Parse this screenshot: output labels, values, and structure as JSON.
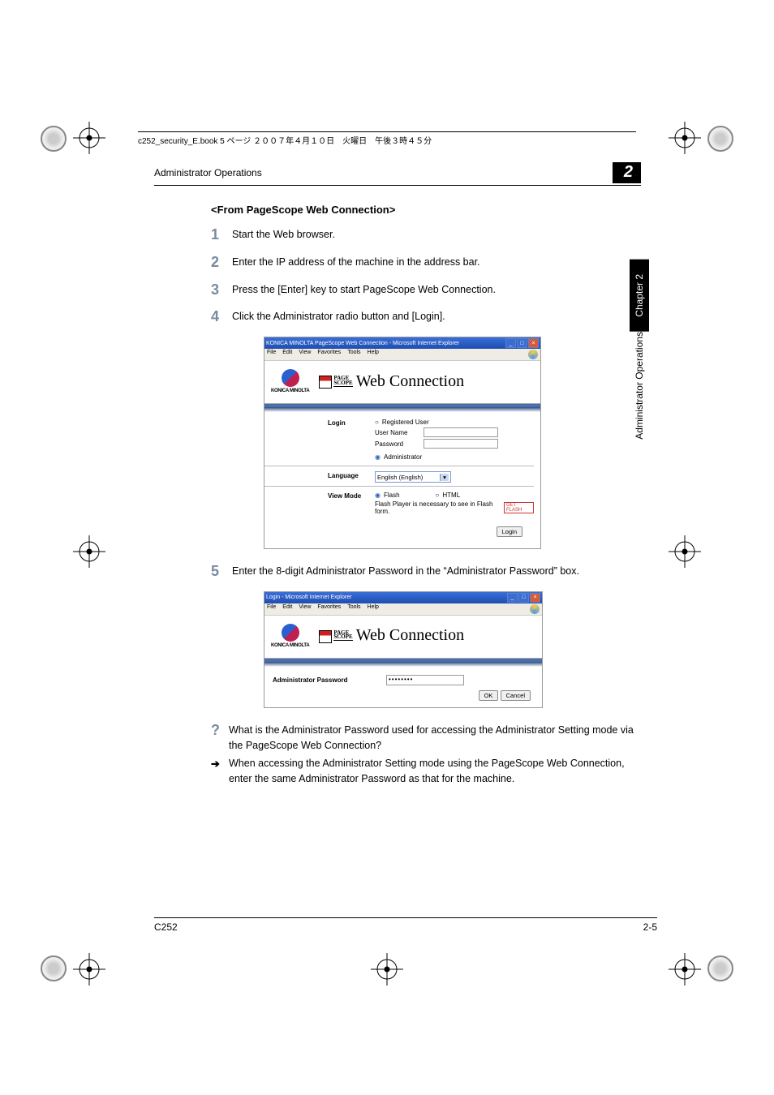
{
  "print_header": "c252_security_E.book  5 ページ  ２００７年４月１０日　火曜日　午後３時４５分",
  "running_head": "Administrator Operations",
  "chapter_number": "2",
  "side_tab": {
    "chapter_label": "Chapter 2",
    "section_label": "Administrator Operations"
  },
  "section_title": "<From PageScope Web Connection>",
  "steps": [
    {
      "num": "1",
      "text": "Start the Web browser."
    },
    {
      "num": "2",
      "text": "Enter the IP address of the machine in the address bar."
    },
    {
      "num": "3",
      "text": "Press the [Enter] key to start PageScope Web Connection."
    },
    {
      "num": "4",
      "text": "Click the Administrator radio button and [Login]."
    },
    {
      "num": "5",
      "text": "Enter the 8-digit Administrator Password in the “Administrator Password” box."
    }
  ],
  "screenshot1": {
    "window_title": "KONICA MINOLTA PageScope Web Connection - Microsoft Internet Explorer",
    "menu": [
      "File",
      "Edit",
      "View",
      "Favorites",
      "Tools",
      "Help"
    ],
    "brand_text": "KONICA MINOLTA",
    "ps_small_top": "PAGE",
    "ps_small_bot": "SCOPE",
    "ps_title": "Web Connection",
    "login": {
      "label": "Login",
      "registered_user": "Registered User",
      "user_name_label": "User Name",
      "password_label": "Password",
      "administrator": "Administrator"
    },
    "language": {
      "label": "Language",
      "value": "English (English)"
    },
    "view_mode": {
      "label": "View Mode",
      "flash": "Flash",
      "html": "HTML",
      "note": "Flash Player is necessary to see in Flash form.",
      "badge": "GET FLASH"
    },
    "login_btn": "Login"
  },
  "screenshot2": {
    "window_title": "Login - Microsoft Internet Explorer",
    "menu": [
      "File",
      "Edit",
      "View",
      "Favorites",
      "Tools",
      "Help"
    ],
    "admin_pw_label": "Administrator Password",
    "pw_value": "••••••••",
    "ok": "OK",
    "cancel": "Cancel"
  },
  "qa": {
    "question": "What is the Administrator Password used for accessing the Administrator Setting mode via the PageScope Web Connection?",
    "answer": "When accessing the Administrator Setting mode using the PageScope Web Connection, enter the same Administrator Password as that for the machine."
  },
  "footer": {
    "left": "C252",
    "right": "2-5"
  }
}
